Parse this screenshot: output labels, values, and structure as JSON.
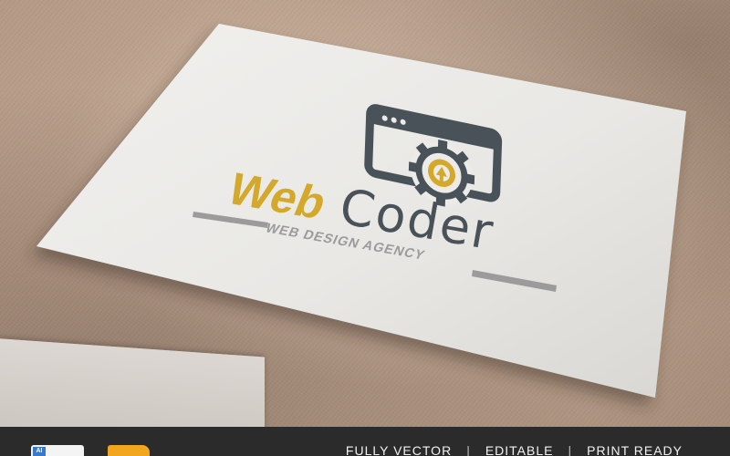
{
  "logo": {
    "word_web": "Web",
    "word_coder": "Coder",
    "tagline": "WEB DESIGN AGENCY",
    "colors": {
      "gold": "#d4a82a",
      "dark": "#4a5259",
      "gray": "#9b9b9b",
      "card": "#ecebe8"
    }
  },
  "bottom_bar": {
    "features": [
      "FULLY VECTOR",
      "EDITABLE",
      "PRINT READY"
    ],
    "separator": "|",
    "icons": [
      "file-format-icon",
      "folder-icon"
    ]
  }
}
